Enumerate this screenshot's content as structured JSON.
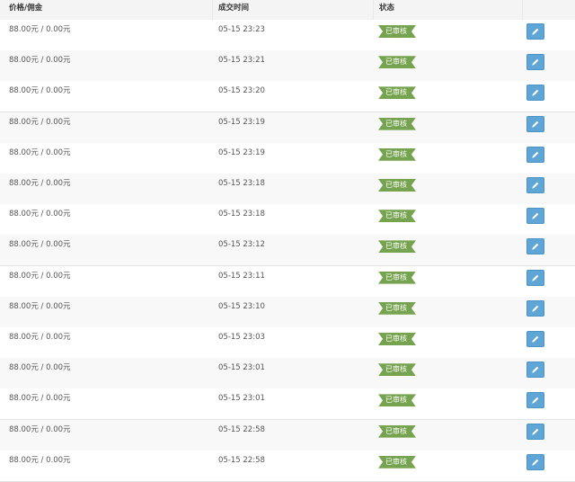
{
  "table": {
    "headers": {
      "price": "价格/佣金",
      "time": "成交时间",
      "status": "状态",
      "actions": ""
    },
    "rows": [
      {
        "price": "88.00元 / 0.00元",
        "time": "05-15 23:23",
        "status": "已审核"
      },
      {
        "price": "88.00元 / 0.00元",
        "time": "05-15 23:21",
        "status": "已审核"
      },
      {
        "price": "88.00元 / 0.00元",
        "time": "05-15 23:20",
        "status": "已审核"
      },
      {
        "price": "88.00元 / 0.00元",
        "time": "05-15 23:19",
        "status": "已审核"
      },
      {
        "price": "88.00元 / 0.00元",
        "time": "05-15 23:19",
        "status": "已审核"
      },
      {
        "price": "88.00元 / 0.00元",
        "time": "05-15 23:18",
        "status": "已审核"
      },
      {
        "price": "88.00元 / 0.00元",
        "time": "05-15 23:18",
        "status": "已审核"
      },
      {
        "price": "88.00元 / 0.00元",
        "time": "05-15 23:12",
        "status": "已审核"
      },
      {
        "price": "88.00元 / 0.00元",
        "time": "05-15 23:11",
        "status": "已审核"
      },
      {
        "price": "88.00元 / 0.00元",
        "time": "05-15 23:10",
        "status": "已审核"
      },
      {
        "price": "88.00元 / 0.00元",
        "time": "05-15 23:03",
        "status": "已审核"
      },
      {
        "price": "88.00元 / 0.00元",
        "time": "05-15 23:01",
        "status": "已审核"
      },
      {
        "price": "88.00元 / 0.00元",
        "time": "05-15 23:01",
        "status": "已审核"
      },
      {
        "price": "88.00元 / 0.00元",
        "time": "05-15 22:58",
        "status": "已审核"
      },
      {
        "price": "88.00元 / 0.00元",
        "time": "05-15 22:58",
        "status": "已审核"
      }
    ]
  },
  "colors": {
    "badge_green": "#76a34f",
    "edit_blue": "#5fa6d6"
  },
  "icons": {
    "edit": "pencil-icon"
  }
}
